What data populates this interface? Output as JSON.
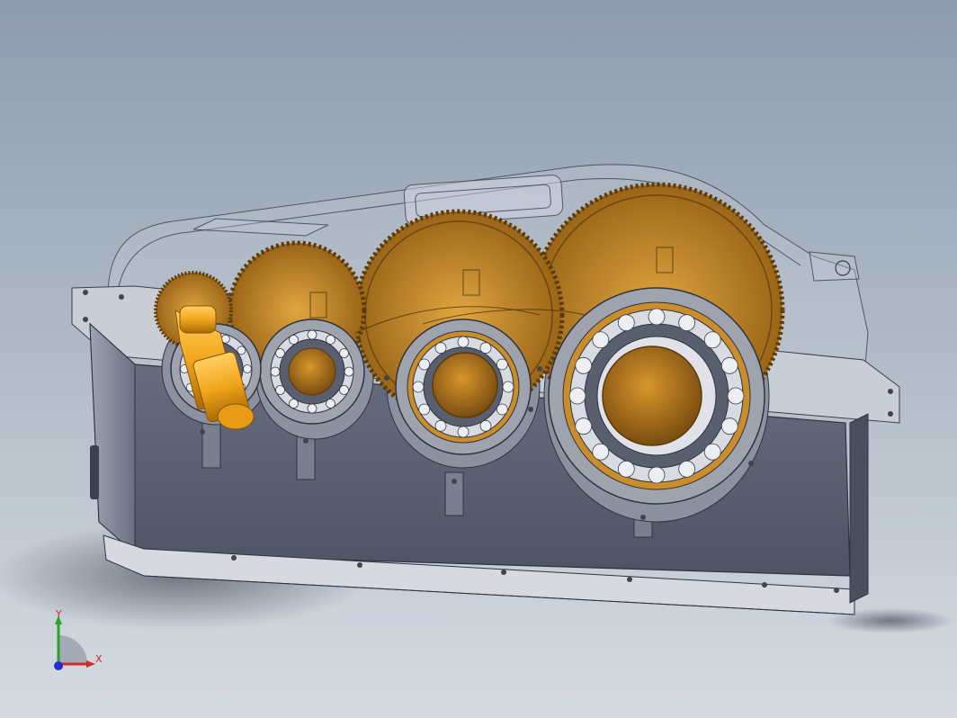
{
  "viewport": {
    "background_top": "#8d9cae",
    "background_bottom": "#d6dbe0"
  },
  "model": {
    "housing_color": "#5f6577",
    "gear_color": "#c98d2b",
    "shaft_color": "#f2a61c",
    "bearing_color": "#b9bcc4"
  },
  "triad": {
    "x_label": "X",
    "y_label": "Y",
    "x_color": "#cc2b2b",
    "y_color": "#2ca02c",
    "z_color": "#2a2ad0"
  }
}
